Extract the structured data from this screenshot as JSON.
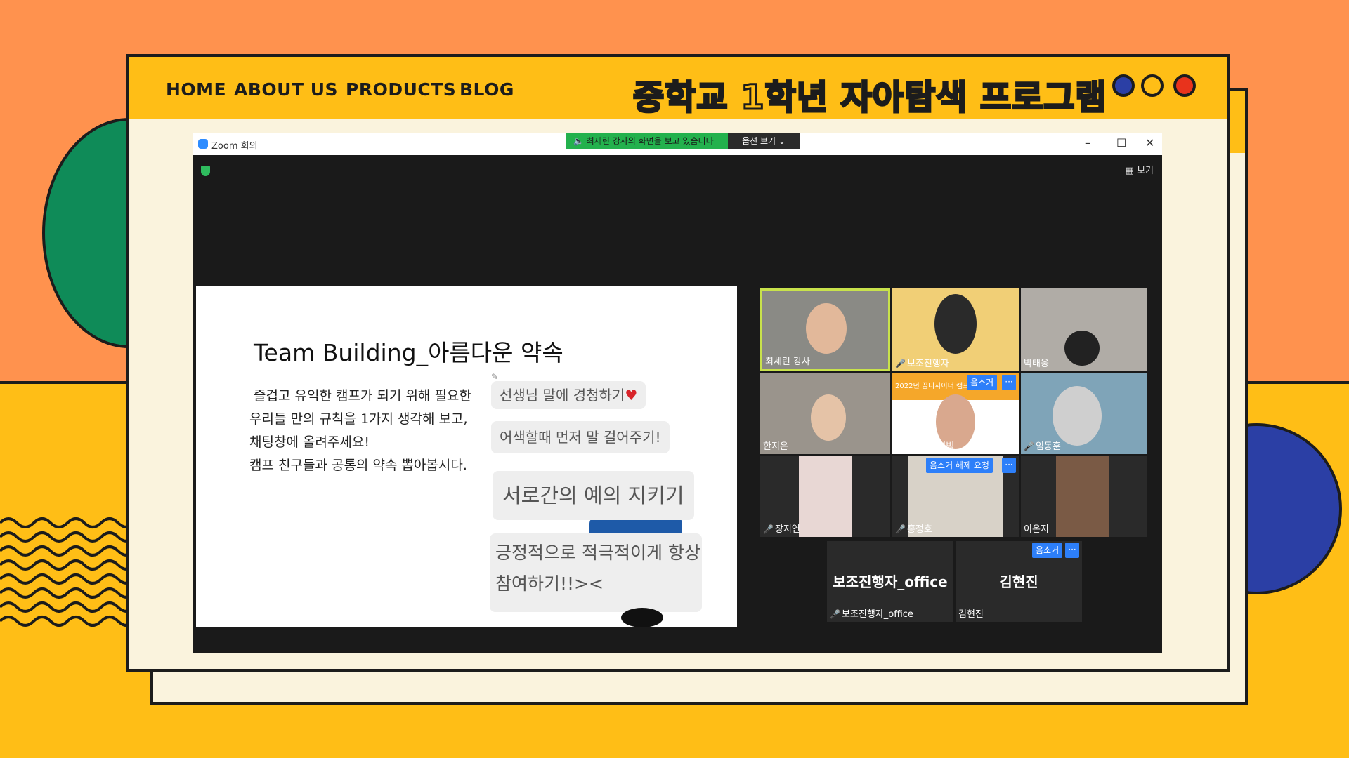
{
  "nav": {
    "home": "HOME",
    "about": "ABOUT US",
    "products": "PRODUCTS",
    "blog": "BLOG",
    "title": "중학교 1학년 자아탐색 프로그램",
    "dot_colors": [
      "#2b3fa5",
      "#ffbe16",
      "#e8331c"
    ]
  },
  "zoom": {
    "window_title": "Zoom 회의",
    "share_banner": "최세린 강사의 화면을 보고 있습니다",
    "view_options": "옵션 보기 ⌄",
    "view_button": "보기",
    "controls": [
      "–",
      "☐",
      "✕"
    ]
  },
  "slide": {
    "title": "Team Building_아름다운 약속",
    "body": [
      "즐겁고 유익한 캠프가 되기 위해 필요한",
      "우리들 만의 규칙을 1가지 생각해 보고,",
      "채팅창에 올려주세요!",
      "캠프 친구들과 공통의 약속 뽑아봅시다."
    ],
    "bubbles": [
      "선생님 말에 경청하기",
      "어색할때 먼저 말 걸어주기!",
      "서로간의 예의 지키기",
      "긍정적으로 적극적이게 항상",
      "참여하기!!><"
    ],
    "heart": "♥"
  },
  "participants": [
    {
      "name": "최세린 강사",
      "muted": false
    },
    {
      "name": "보조진행자",
      "muted": true
    },
    {
      "name": "박태웅",
      "muted": false
    },
    {
      "name": "한지은",
      "muted": false
    },
    {
      "name": "꿈디중1 진영범",
      "muted": false,
      "tag": "음소거",
      "banner": "2022년 꿈디자이너 캠프"
    },
    {
      "name": "임동훈",
      "muted": true
    },
    {
      "name": "장지연",
      "muted": true
    },
    {
      "name": "홍정호",
      "muted": true,
      "tag": "음소거 해제 요청"
    },
    {
      "name": "이온지",
      "muted": false
    }
  ],
  "name_tiles": [
    {
      "display": "보조진행자_office",
      "name": "보조진행자_office",
      "muted": true
    },
    {
      "display": "김현진",
      "name": "김현진",
      "muted": false,
      "tag": "음소거"
    }
  ],
  "more_label": "···"
}
